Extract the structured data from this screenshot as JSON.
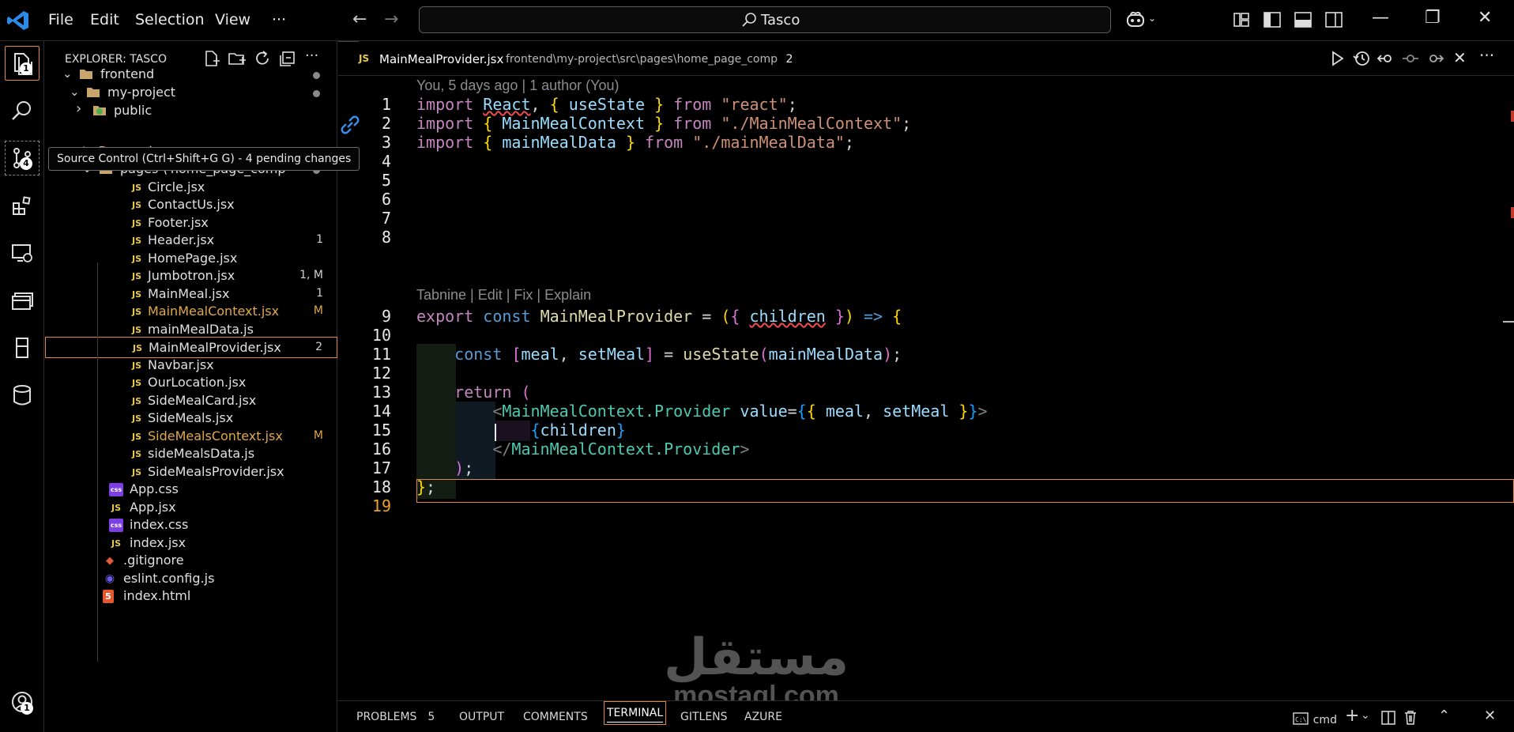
{
  "titlebar": {
    "menus": [
      "File",
      "Edit",
      "Selection",
      "View",
      "···"
    ],
    "search_text": "Tasco"
  },
  "activity": {
    "explorer_badge": "1",
    "source_control_badge": "4",
    "accounts_badge": "1"
  },
  "tooltip": "Source Control (Ctrl+Shift+G G) - 4 pending changes",
  "sidebar": {
    "title": "EXPLORER: TASCO",
    "tree": [
      {
        "label": "frontend",
        "type": "folder-open",
        "depth": 0,
        "dot": true
      },
      {
        "label": "my-project",
        "type": "folder-open",
        "depth": 1,
        "dot": true
      },
      {
        "label": "public",
        "type": "folder-closed",
        "depth": 2
      },
      {
        "label": "assets",
        "type": "folder-closed",
        "depth": 3
      },
      {
        "label": "pages \\ home_page_comp",
        "type": "folder-open",
        "depth": 3,
        "dot": true
      },
      {
        "label": "Circle.jsx",
        "type": "js",
        "depth": 4
      },
      {
        "label": "ContactUs.jsx",
        "type": "js",
        "depth": 4
      },
      {
        "label": "Footer.jsx",
        "type": "js",
        "depth": 4
      },
      {
        "label": "Header.jsx",
        "type": "js",
        "depth": 4,
        "status": "1"
      },
      {
        "label": "HomePage.jsx",
        "type": "js",
        "depth": 4
      },
      {
        "label": "Jumbotron.jsx",
        "type": "js",
        "depth": 4,
        "status": "1, M"
      },
      {
        "label": "MainMeal.jsx",
        "type": "js",
        "depth": 4,
        "status": "1"
      },
      {
        "label": "MainMealContext.jsx",
        "type": "js",
        "depth": 4,
        "status": "M",
        "modified": true
      },
      {
        "label": "mainMealData.js",
        "type": "js",
        "depth": 4
      },
      {
        "label": "MainMealProvider.jsx",
        "type": "js",
        "depth": 4,
        "status": "2",
        "selected": true
      },
      {
        "label": "Navbar.jsx",
        "type": "js",
        "depth": 4
      },
      {
        "label": "OurLocation.jsx",
        "type": "js",
        "depth": 4
      },
      {
        "label": "SideMealCard.jsx",
        "type": "js",
        "depth": 4
      },
      {
        "label": "SideMeals.jsx",
        "type": "js",
        "depth": 4
      },
      {
        "label": "SideMealsContext.jsx",
        "type": "js",
        "depth": 4,
        "status": "M",
        "modified": true
      },
      {
        "label": "sideMealsData.js",
        "type": "js",
        "depth": 4
      },
      {
        "label": "SideMealsProvider.jsx",
        "type": "js",
        "depth": 4
      },
      {
        "label": "App.css",
        "type": "css",
        "depth": 3
      },
      {
        "label": "App.jsx",
        "type": "js",
        "depth": 3
      },
      {
        "label": "index.css",
        "type": "css",
        "depth": 3
      },
      {
        "label": "index.jsx",
        "type": "js",
        "depth": 3
      },
      {
        "label": ".gitignore",
        "type": "git",
        "depth": 2
      },
      {
        "label": "eslint.config.js",
        "type": "eslint",
        "depth": 2
      },
      {
        "label": "index.html",
        "type": "html",
        "depth": 2
      }
    ]
  },
  "editor": {
    "tab_name": "MainMealProvider.jsx",
    "tab_path": "frontend\\my-project\\src\\pages\\home_page_comp",
    "tab_problems": "2",
    "blame": "You, 5 days ago | 1 author (You)",
    "codelens": "Tabnine | Edit | Fix | Explain",
    "line_numbers": [
      "1",
      "2",
      "3",
      "4",
      "5",
      "6",
      "7",
      "8",
      "9",
      "10",
      "11",
      "12",
      "13",
      "14",
      "15",
      "16",
      "17",
      "18",
      "19"
    ],
    "current_line": "19"
  },
  "panel": {
    "tabs": [
      "PROBLEMS",
      "OUTPUT",
      "COMMENTS",
      "TERMINAL",
      "GITLENS",
      "AZURE"
    ],
    "problems_count": "5",
    "active_tab": "TERMINAL",
    "terminal_name": "cmd"
  },
  "watermark": {
    "arabic": "مستقل",
    "latin": "mostaql.com"
  },
  "colors": {
    "accent_border": "#e08a3c",
    "keyword": "#c586c0",
    "storage": "#569cd6",
    "string": "#ce9178",
    "component": "#4ec9b0",
    "variable": "#9cdcfe"
  }
}
